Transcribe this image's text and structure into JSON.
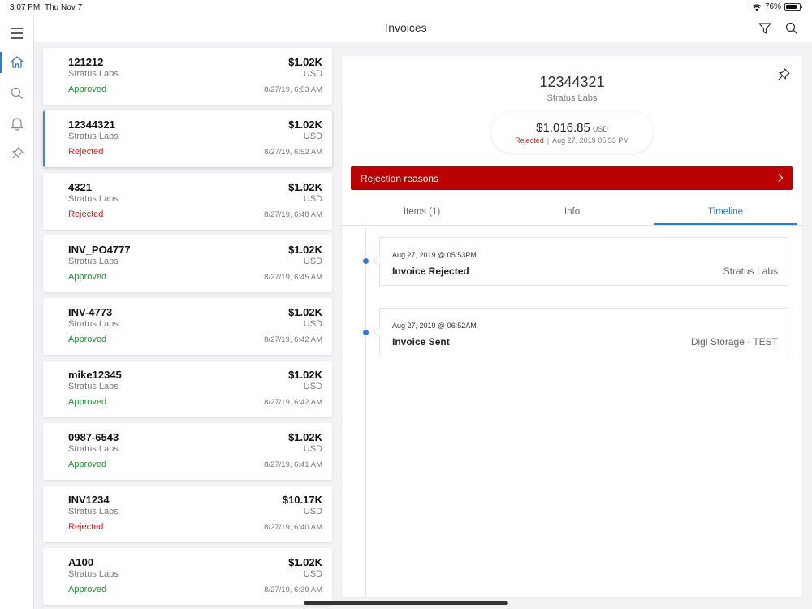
{
  "status_bar": {
    "time": "3:07 PM",
    "date": "Thu Nov 7",
    "battery": "76%"
  },
  "header": {
    "title": "Invoices"
  },
  "invoices": [
    {
      "id": "121212",
      "vendor": "Stratus Labs",
      "status": "Approved",
      "amount": "$1.02K",
      "currency": "USD",
      "date": "8/27/19, 6:53 AM"
    },
    {
      "id": "12344321",
      "vendor": "Stratus Labs",
      "status": "Rejected",
      "amount": "$1.02K",
      "currency": "USD",
      "date": "8/27/19, 6:52 AM"
    },
    {
      "id": "4321",
      "vendor": "Stratus Labs",
      "status": "Rejected",
      "amount": "$1.02K",
      "currency": "USD",
      "date": "8/27/19, 6:48 AM"
    },
    {
      "id": "INV_PO4777",
      "vendor": "Stratus Labs",
      "status": "Approved",
      "amount": "$1.02K",
      "currency": "USD",
      "date": "8/27/19, 6:45 AM"
    },
    {
      "id": "INV-4773",
      "vendor": "Stratus Labs",
      "status": "Approved",
      "amount": "$1.02K",
      "currency": "USD",
      "date": "8/27/19, 6:42 AM"
    },
    {
      "id": "mike12345",
      "vendor": "Stratus Labs",
      "status": "Approved",
      "amount": "$1.02K",
      "currency": "USD",
      "date": "8/27/19, 6:42 AM"
    },
    {
      "id": "0987-6543",
      "vendor": "Stratus Labs",
      "status": "Approved",
      "amount": "$1.02K",
      "currency": "USD",
      "date": "8/27/19, 6:41 AM"
    },
    {
      "id": "INV1234",
      "vendor": "Stratus Labs",
      "status": "Rejected",
      "amount": "$10.17K",
      "currency": "USD",
      "date": "8/27/19, 6:40 AM"
    },
    {
      "id": "A100",
      "vendor": "Stratus Labs",
      "status": "Approved",
      "amount": "$1.02K",
      "currency": "USD",
      "date": "8/27/19, 6:39 AM"
    }
  ],
  "detail": {
    "id": "12344321",
    "vendor": "Stratus Labs",
    "amount": "$1,016.85",
    "currency": "USD",
    "status": "Rejected",
    "status_date": "Aug 27, 2019 05:53 PM",
    "rejection_label": "Rejection reasons",
    "tabs": [
      {
        "label": "Items (1)"
      },
      {
        "label": "Info"
      },
      {
        "label": "Timeline"
      }
    ],
    "active_tab": "Timeline",
    "timeline": [
      {
        "date": "Aug 27, 2019 @ 05:53PM",
        "title": "Invoice Rejected",
        "who": "Stratus Labs"
      },
      {
        "date": "Aug 27, 2019 @ 06:52AM",
        "title": "Invoice Sent",
        "who": "Digi Storage - TEST"
      }
    ]
  },
  "colors": {
    "accent": "#2b7cd3",
    "approved": "#2a8a3a",
    "rejected": "#c62828",
    "reasons_bg": "#bb0000"
  }
}
